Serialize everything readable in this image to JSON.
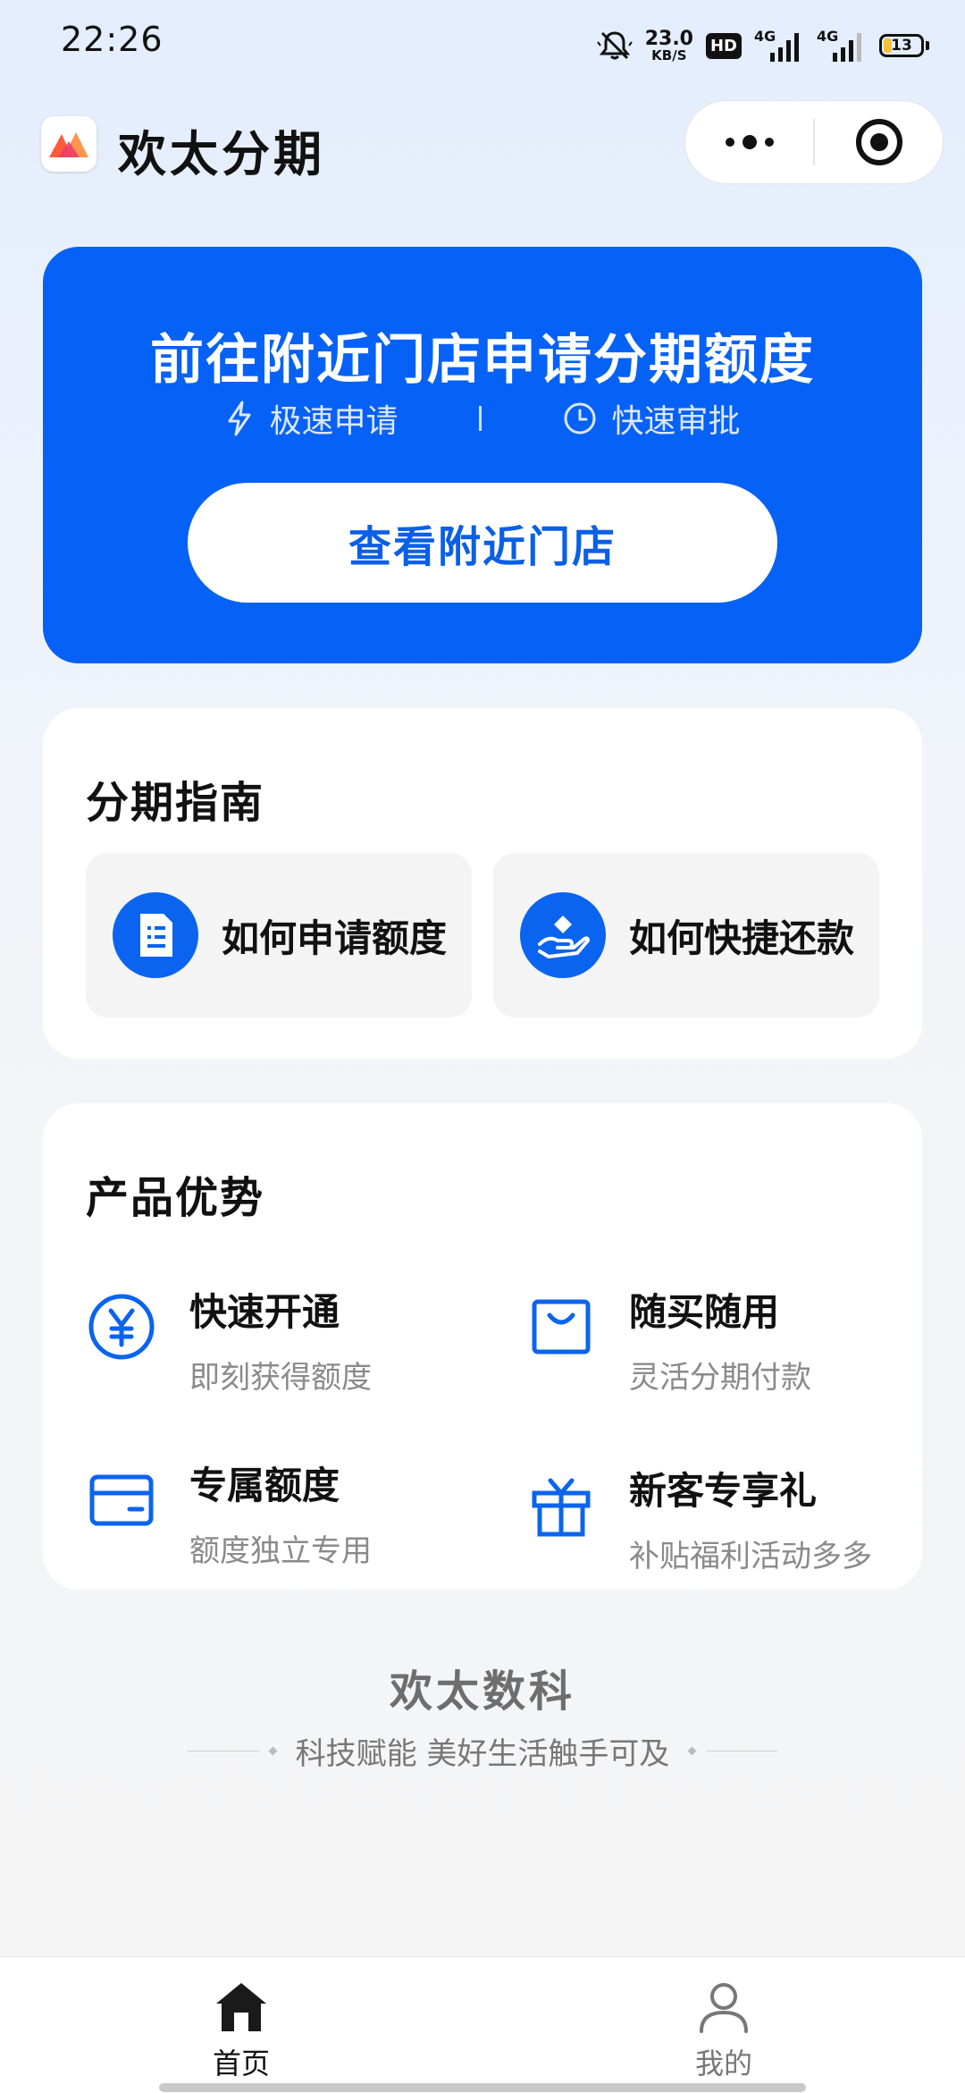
{
  "status_bar": {
    "time": "22:26",
    "net_speed": "23.0",
    "net_unit": "KB/S",
    "hd_badge": "HD",
    "sim1_label": "4G",
    "sim2_label": "4G",
    "battery_level": "13",
    "icons": [
      "mute-icon",
      "signal-icon",
      "battery-icon"
    ]
  },
  "header": {
    "app_title": "欢太分期",
    "logo_icon": "app-logo-icon",
    "capsule_icons": [
      "more-icon",
      "close-miniprogram-icon"
    ]
  },
  "hero": {
    "title": "前往附近门店申请分期额度",
    "features": [
      {
        "label": "极速申请",
        "icon": "lightning-icon"
      },
      {
        "label": "快速审批",
        "icon": "clock-icon"
      }
    ],
    "button_label": "查看附近门店"
  },
  "guide": {
    "title": "分期指南",
    "items": [
      {
        "label": "如何申请额度",
        "icon": "document-icon"
      },
      {
        "label": "如何快捷还款",
        "icon": "hand-coin-icon"
      }
    ]
  },
  "products": {
    "title": "产品优势",
    "items": [
      {
        "title": "快速开通",
        "subtitle": "即刻获得额度",
        "icon": "yen-icon"
      },
      {
        "title": "随买随用",
        "subtitle": "灵活分期付款",
        "icon": "shopping-bag-icon"
      },
      {
        "title": "专属额度",
        "subtitle": "额度独立专用",
        "icon": "card-icon"
      },
      {
        "title": "新客专享礼",
        "subtitle": "补贴福利活动多多",
        "icon": "gift-icon"
      }
    ]
  },
  "footer_brand": {
    "name": "欢太数科",
    "slogan": "科技赋能 美好生活触手可及"
  },
  "tabbar": {
    "tabs": [
      {
        "label": "首页",
        "icon": "home-icon",
        "active": true
      },
      {
        "label": "我的",
        "icon": "profile-icon",
        "active": false
      }
    ]
  },
  "colors": {
    "primary": "#0661f6",
    "text": "#111111",
    "muted": "#8a8a8a",
    "card": "#ffffff"
  }
}
